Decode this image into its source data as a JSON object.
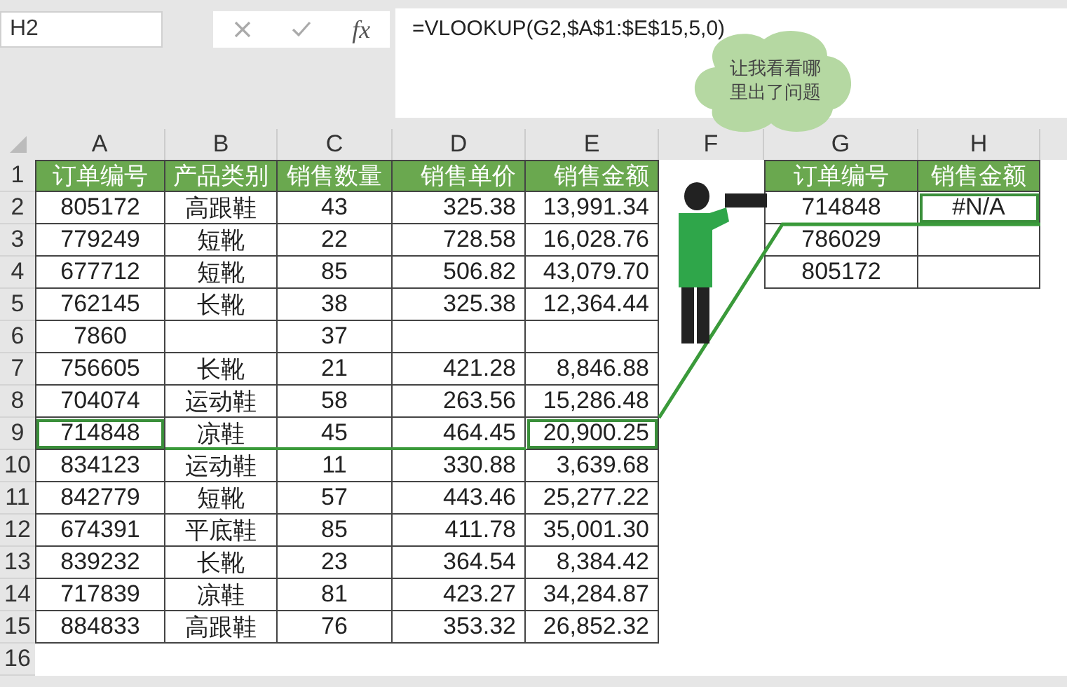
{
  "name_box": "H2",
  "formula_bar": {
    "function_label": "fx",
    "formula": "=VLOOKUP(G2,$A$1:$E$15,5,0)"
  },
  "thought_bubble": "让我看看哪里出了问题",
  "columns": [
    "A",
    "B",
    "C",
    "D",
    "E",
    "F",
    "G",
    "H"
  ],
  "rows": [
    {
      "number": "1",
      "cells": [
        {
          "text": "订单编号",
          "kind": "header",
          "selected": false
        },
        {
          "text": "产品类别",
          "kind": "header",
          "selected": false
        },
        {
          "text": "销售数量",
          "kind": "header",
          "selected": false
        },
        {
          "text": "销售单价",
          "kind": "header",
          "selected": false
        },
        {
          "text": "销售金额",
          "kind": "header",
          "selected": false
        },
        null,
        {
          "text": "订单编号",
          "kind": "header",
          "selected": false
        },
        {
          "text": "销售金额",
          "kind": "header",
          "selected": false
        }
      ]
    },
    {
      "number": "2",
      "cells": [
        {
          "text": "805172",
          "kind": "data",
          "selected": false
        },
        {
          "text": "高跟鞋",
          "kind": "data",
          "selected": false
        },
        {
          "text": "43",
          "kind": "data",
          "selected": false
        },
        {
          "text": "325.38",
          "kind": "data",
          "selected": false
        },
        {
          "text": "13,991.34",
          "kind": "data",
          "selected": false
        },
        null,
        {
          "text": "714848",
          "kind": "data",
          "selected": false
        },
        {
          "text": "#N/A",
          "kind": "data",
          "selected": true
        }
      ]
    },
    {
      "number": "3",
      "cells": [
        {
          "text": "779249",
          "kind": "data",
          "selected": false
        },
        {
          "text": "短靴",
          "kind": "data",
          "selected": false
        },
        {
          "text": "22",
          "kind": "data",
          "selected": false
        },
        {
          "text": "728.58",
          "kind": "data",
          "selected": false
        },
        {
          "text": "16,028.76",
          "kind": "data",
          "selected": false
        },
        null,
        {
          "text": "786029",
          "kind": "data",
          "selected": false
        },
        {
          "kind": "blank",
          "selected": false
        }
      ]
    },
    {
      "number": "4",
      "cells": [
        {
          "text": "677712",
          "kind": "data",
          "selected": false
        },
        {
          "text": "短靴",
          "kind": "data",
          "selected": false
        },
        {
          "text": "85",
          "kind": "data",
          "selected": false
        },
        {
          "text": "506.82",
          "kind": "data",
          "selected": false
        },
        {
          "text": "43,079.70",
          "kind": "data",
          "selected": false
        },
        null,
        {
          "text": "805172",
          "kind": "data",
          "selected": false
        },
        {
          "kind": "blank",
          "selected": false
        }
      ]
    },
    {
      "number": "5",
      "cells": [
        {
          "text": "762145",
          "kind": "data",
          "selected": false
        },
        {
          "text": "长靴",
          "kind": "data",
          "selected": false
        },
        {
          "text": "38",
          "kind": "data",
          "selected": false
        },
        {
          "text": "325.38",
          "kind": "data",
          "selected": false
        },
        {
          "text": "12,364.44",
          "kind": "data",
          "selected": false
        },
        null,
        null,
        null
      ]
    },
    {
      "number": "6",
      "cells": [
        {
          "text": "7860",
          "kind": "data",
          "selected": false
        },
        {
          "kind": "blank",
          "selected": false
        },
        {
          "text": "37",
          "kind": "data",
          "selected": false
        },
        {
          "kind": "blank",
          "selected": false
        },
        {
          "kind": "blank",
          "selected": false
        },
        null,
        null,
        null
      ]
    },
    {
      "number": "7",
      "cells": [
        {
          "text": "756605",
          "kind": "data",
          "selected": false
        },
        {
          "text": "长靴",
          "kind": "data",
          "selected": false
        },
        {
          "text": "21",
          "kind": "data",
          "selected": false
        },
        {
          "text": "421.28",
          "kind": "data",
          "selected": false
        },
        {
          "text": "8,846.88",
          "kind": "data",
          "selected": false
        },
        null,
        null,
        null
      ]
    },
    {
      "number": "8",
      "cells": [
        {
          "text": "704074",
          "kind": "data",
          "selected": false
        },
        {
          "text": "运动鞋",
          "kind": "data",
          "selected": false
        },
        {
          "text": "58",
          "kind": "data",
          "selected": false
        },
        {
          "text": "263.56",
          "kind": "data",
          "selected": false
        },
        {
          "text": "15,286.48",
          "kind": "data",
          "selected": false
        },
        null,
        null,
        null
      ]
    },
    {
      "number": "9",
      "cells": [
        {
          "text": "714848",
          "kind": "data",
          "selected": true
        },
        {
          "text": "凉鞋",
          "kind": "data",
          "selected": false
        },
        {
          "text": "45",
          "kind": "data",
          "selected": false
        },
        {
          "text": "464.45",
          "kind": "data",
          "selected": false
        },
        {
          "text": "20,900.25",
          "kind": "data",
          "selected": true
        },
        null,
        null,
        null
      ]
    },
    {
      "number": "10",
      "cells": [
        {
          "text": "834123",
          "kind": "data",
          "selected": false
        },
        {
          "text": "运动鞋",
          "kind": "data",
          "selected": false
        },
        {
          "text": "11",
          "kind": "data",
          "selected": false
        },
        {
          "text": "330.88",
          "kind": "data",
          "selected": false
        },
        {
          "text": "3,639.68",
          "kind": "data",
          "selected": false
        },
        null,
        null,
        null
      ]
    },
    {
      "number": "11",
      "cells": [
        {
          "text": "842779",
          "kind": "data",
          "selected": false
        },
        {
          "text": "短靴",
          "kind": "data",
          "selected": false
        },
        {
          "text": "57",
          "kind": "data",
          "selected": false
        },
        {
          "text": "443.46",
          "kind": "data",
          "selected": false
        },
        {
          "text": "25,277.22",
          "kind": "data",
          "selected": false
        },
        null,
        null,
        null
      ]
    },
    {
      "number": "12",
      "cells": [
        {
          "text": "674391",
          "kind": "data",
          "selected": false
        },
        {
          "text": "平底鞋",
          "kind": "data",
          "selected": false
        },
        {
          "text": "85",
          "kind": "data",
          "selected": false
        },
        {
          "text": "411.78",
          "kind": "data",
          "selected": false
        },
        {
          "text": "35,001.30",
          "kind": "data",
          "selected": false
        },
        null,
        null,
        null
      ]
    },
    {
      "number": "13",
      "cells": [
        {
          "text": "839232",
          "kind": "data",
          "selected": false
        },
        {
          "text": "长靴",
          "kind": "data",
          "selected": false
        },
        {
          "text": "23",
          "kind": "data",
          "selected": false
        },
        {
          "text": "364.54",
          "kind": "data",
          "selected": false
        },
        {
          "text": "8,384.42",
          "kind": "data",
          "selected": false
        },
        null,
        null,
        null
      ]
    },
    {
      "number": "14",
      "cells": [
        {
          "text": "717839",
          "kind": "data",
          "selected": false
        },
        {
          "text": "凉鞋",
          "kind": "data",
          "selected": false
        },
        {
          "text": "81",
          "kind": "data",
          "selected": false
        },
        {
          "text": "423.27",
          "kind": "data",
          "selected": false
        },
        {
          "text": "34,284.87",
          "kind": "data",
          "selected": false
        },
        null,
        null,
        null
      ]
    },
    {
      "number": "15",
      "cells": [
        {
          "text": "884833",
          "kind": "data",
          "selected": false
        },
        {
          "text": "高跟鞋",
          "kind": "data",
          "selected": false
        },
        {
          "text": "76",
          "kind": "data",
          "selected": false
        },
        {
          "text": "353.32",
          "kind": "data",
          "selected": false
        },
        {
          "text": "26,852.32",
          "kind": "data",
          "selected": false
        },
        null,
        null,
        null
      ]
    },
    {
      "number": "16",
      "cells": [
        null,
        null,
        null,
        null,
        null,
        null,
        null,
        null
      ]
    }
  ]
}
